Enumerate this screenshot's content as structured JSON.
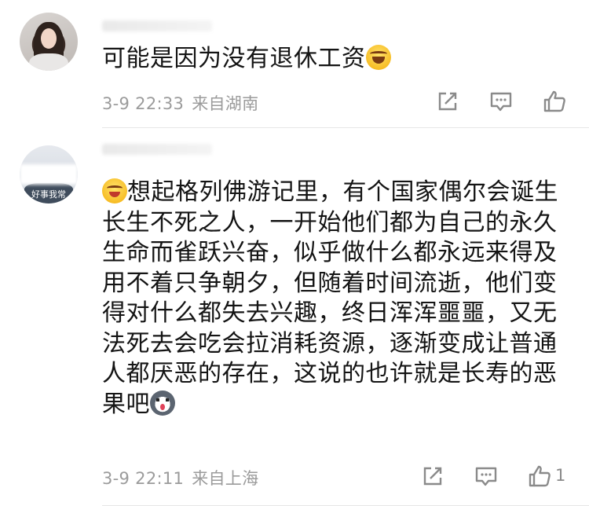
{
  "comments": [
    {
      "text": "可能是因为没有退休工资",
      "emoji": "laugh-cry-emoji",
      "time": "3-9 22:33",
      "location": "来自湖南",
      "like_count": ""
    },
    {
      "lead_emoji": "wink-emoji",
      "text": "想起格列佛游记里，有个国家偶尔会诞生长生不死之人，一开始他们都为自己的永久生命而雀跃兴奋，似乎做什么都永远来得及用不着只争朝夕，但随着时间流逝，他们变得对什么都失去兴趣，终日浑浑噩噩，又无法死去会吃会拉消耗资源，逐渐变成让普通人都厌恶的存在，这说的也许就是长寿的恶果吧",
      "emoji": "husky-emoji",
      "avatar_text": "好事我常",
      "time": "3-9 22:11",
      "location": "来自上海",
      "like_count": "1"
    }
  ],
  "icons": {
    "share": "share-icon",
    "reply": "reply-icon",
    "like": "thumbs-up-icon"
  },
  "colors": {
    "text": "#141414",
    "meta": "#9b9b9b",
    "icon": "#8a8a8a",
    "divider": "#e6e6e6"
  }
}
